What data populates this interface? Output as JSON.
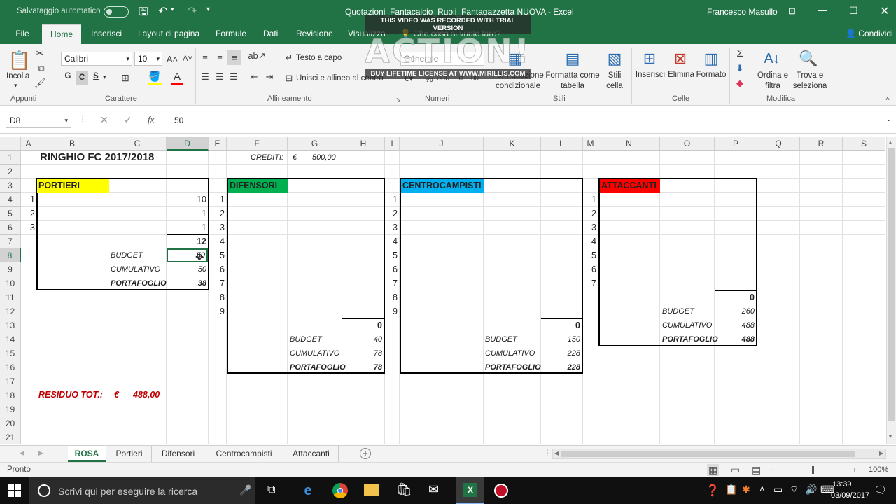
{
  "window": {
    "autosave": "Salvataggio automatico",
    "filename": "Quotazioni_Fantacalcio_Ruoli_Fantagazzetta NUOVA  -  Excel",
    "user": "Francesco Masullo"
  },
  "tabs": [
    "File",
    "Home",
    "Inserisci",
    "Layout di pagina",
    "Formule",
    "Dati",
    "Revisione",
    "Visualizza",
    "Che cosa si vuole fare?",
    "Condividi"
  ],
  "ribbon": {
    "appunti": {
      "incolla": "Incolla",
      "group": "Appunti"
    },
    "carattere": {
      "font": "Calibri",
      "size": "10",
      "bold": "G",
      "italic": "C",
      "underline": "S",
      "group": "Carattere"
    },
    "allineamento": {
      "testo_a_capo": "Testo a capo",
      "unisci": "Unisci e allinea al centro",
      "group": "Allineamento"
    },
    "numeri": {
      "format": "Generale",
      "group": "Numeri"
    },
    "stili": {
      "formattazione": "Formattazione condizionale",
      "formatta": "Formatta come tabella",
      "stili_cella": "Stili cella",
      "group": "Stili"
    },
    "celle": {
      "inserisci": "Inserisci",
      "elimina": "Elimina",
      "formato": "Formato",
      "group": "Celle"
    },
    "modifica": {
      "ordina": "Ordina e filtra",
      "trova": "Trova e seleziona",
      "group": "Modifica"
    }
  },
  "formula_bar": {
    "name_box": "D8",
    "fx": "fx",
    "value": "50"
  },
  "watermark": {
    "top": "THIS VIDEO WAS RECORDED WITH TRIAL VERSION",
    "logo": "ACTION!",
    "bottom": "BUY LIFETIME LICENSE AT WWW.MIRILLIS.COM"
  },
  "columns": [
    "A",
    "B",
    "C",
    "D",
    "E",
    "F",
    "G",
    "H",
    "I",
    "J",
    "K",
    "L",
    "M",
    "N",
    "O",
    "P",
    "Q",
    "R",
    "S"
  ],
  "rows": [
    "1",
    "2",
    "3",
    "4",
    "5",
    "6",
    "7",
    "8",
    "9",
    "10",
    "11",
    "12",
    "13",
    "14",
    "15",
    "16",
    "17",
    "18",
    "19",
    "20",
    "21"
  ],
  "sheet": {
    "title": "RINGHIO FC 2017/2018",
    "crediti_label": "CREDITI:",
    "crediti_currency": "€",
    "crediti_value": "500,00",
    "portieri": {
      "header": "PORTIERI",
      "nums": [
        "1",
        "2",
        "3"
      ],
      "values": [
        "10",
        "1",
        "1"
      ],
      "total": "12",
      "budget_label": "BUDGET",
      "budget": "50",
      "cumulativo_label": "CUMULATIVO",
      "cumulativo": "50",
      "portafoglio_label": "PORTAFOGLIO",
      "portafoglio": "38"
    },
    "difensori": {
      "header": "DIFENSORI",
      "nums": [
        "1",
        "2",
        "3",
        "4",
        "5",
        "6",
        "7",
        "8",
        "9"
      ],
      "total": "0",
      "budget_label": "BUDGET",
      "budget": "40",
      "cumulativo_label": "CUMULATIVO",
      "cumulativo": "78",
      "portafoglio_label": "PORTAFOGLIO",
      "portafoglio": "78"
    },
    "centrocampisti": {
      "header": "CENTROCAMPISTI",
      "nums": [
        "1",
        "2",
        "3",
        "4",
        "5",
        "6",
        "7",
        "8",
        "9"
      ],
      "total": "0",
      "budget_label": "BUDGET",
      "budget": "150",
      "cumulativo_label": "CUMULATIVO",
      "cumulativo": "228",
      "portafoglio_label": "PORTAFOGLIO",
      "portafoglio": "228"
    },
    "attaccanti": {
      "header": "ATTACCANTI",
      "nums": [
        "1",
        "2",
        "3",
        "4",
        "5",
        "6",
        "7"
      ],
      "total": "0",
      "budget_label": "BUDGET",
      "budget": "260",
      "cumulativo_label": "CUMULATIVO",
      "cumulativo": "488",
      "portafoglio_label": "PORTAFOGLIO",
      "portafoglio": "488"
    },
    "residuo_label": "RESIDUO TOT.:",
    "residuo_currency": "€",
    "residuo_value": "488,00"
  },
  "sheet_tabs": [
    "ROSA",
    "Portieri",
    "Difensori",
    "Centrocampisti",
    "Attaccanti"
  ],
  "status": {
    "ready": "Pronto",
    "zoom": "100%"
  },
  "taskbar": {
    "search": "Scrivi qui per eseguire la ricerca",
    "time": "13:39",
    "date": "03/09/2017"
  },
  "colors": {
    "excel_green": "#217346",
    "portieri": "#ffff00",
    "difensori": "#00b050",
    "centrocampisti": "#00b0f0",
    "attaccanti": "#ff0000",
    "residuo": "#c00000"
  }
}
